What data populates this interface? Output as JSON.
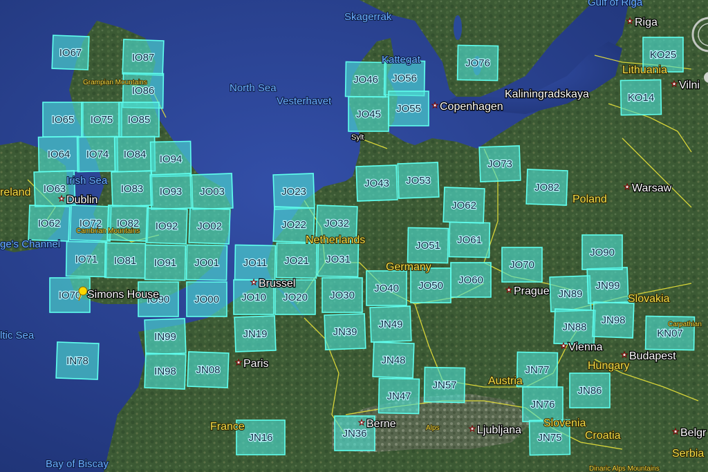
{
  "grid_squares": [
    "IO67",
    "IO87",
    "IO86",
    "IO65",
    "IO75",
    "IO85",
    "IO64",
    "IO74",
    "IO84",
    "IO94",
    "IO63",
    "IO83",
    "IO93",
    "JO03",
    "IO62",
    "IO72",
    "IO82",
    "IO92",
    "JO02",
    "IO71",
    "IO81",
    "IO91",
    "JO01",
    "IO70",
    "IO90",
    "JO00",
    "IN99",
    "IN98",
    "JN08",
    "IN78",
    "JO11",
    "JO10",
    "JO21",
    "JO20",
    "JN19",
    "JO23",
    "JO22",
    "JO32",
    "JO31",
    "JO30",
    "JN39",
    "JO43",
    "JO53",
    "JO62",
    "JO51",
    "JO61",
    "JO40",
    "JO50",
    "JO60",
    "JN49",
    "JN48",
    "JN47",
    "JN57",
    "JN36",
    "JN16",
    "JO46",
    "JO56",
    "JO45",
    "JO55",
    "JO76",
    "JO73",
    "JO82",
    "JO70",
    "JN89",
    "JN99",
    "JO90",
    "JN88",
    "JN98",
    "JN77",
    "JN76",
    "JN86",
    "JN75",
    "KN07",
    "KO25",
    "KO14"
  ],
  "places": [
    "Simons House",
    "Dublin",
    "Brussel",
    "Paris",
    "Berne",
    "Prague",
    "Vienna",
    "Budapest",
    "Copenhagen",
    "Warsaw",
    "Riga",
    "Vilni",
    "Ljubljana",
    "Belgr"
  ],
  "countries": [
    "reland",
    "Netherlands",
    "Germany",
    "Poland",
    "France",
    "Austria",
    "Slovakia",
    "Hungary",
    "Slovenia",
    "Croatia",
    "Serbia",
    "Lithuania",
    "Kaliningradskaya",
    "Sylt"
  ],
  "seas": [
    "North Sea",
    "Vesterhavet",
    "Irish Sea",
    "ge's Channel",
    "ltic Sea",
    "Bay of Biscay",
    "Skagerrak",
    "Kattegat",
    "Gulf of Riga"
  ],
  "mountains": [
    "Grampian Mountains",
    "Cambrian Mountains",
    "Alps",
    "Carpathian",
    "Dinaric Alps Mountains"
  ],
  "colors": {
    "grid_fill": "#4de0d4",
    "grid_stroke": "#60ffee",
    "grid_label": "#0d2a3d",
    "border": "#e8e23a",
    "sea": "#2a4a99",
    "land": "#3f5c36",
    "marker": "#ffd800"
  }
}
